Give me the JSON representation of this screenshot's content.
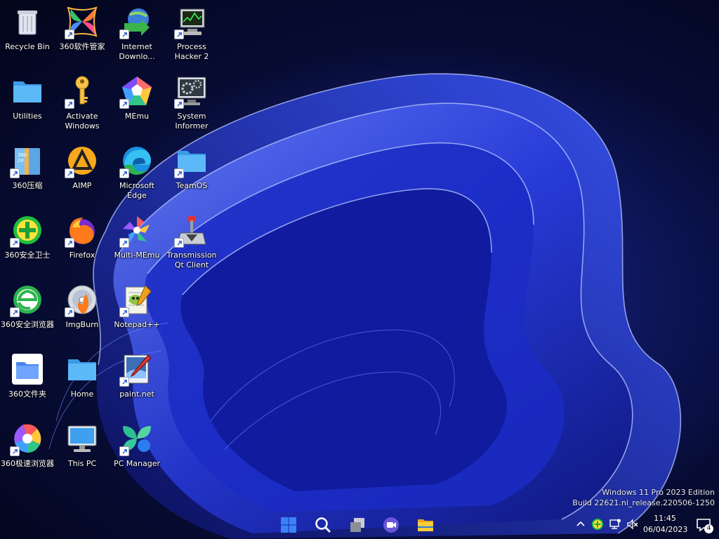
{
  "desktop_icons": [
    {
      "label": "Recycle Bin",
      "icon": "recycle-bin-icon",
      "shortcut": false
    },
    {
      "label": "360软件管家",
      "icon": "360-software-manager-icon",
      "shortcut": true
    },
    {
      "label": "Internet Downlo...",
      "icon": "internet-download-manager-icon",
      "shortcut": true
    },
    {
      "label": "Process Hacker 2",
      "icon": "process-hacker-icon",
      "shortcut": true
    },
    {
      "label": "Utilities",
      "icon": "folder-icon",
      "shortcut": false
    },
    {
      "label": "Activate Windows",
      "icon": "key-icon",
      "shortcut": true
    },
    {
      "label": "MEmu",
      "icon": "memu-icon",
      "shortcut": true
    },
    {
      "label": "System Informer",
      "icon": "system-informer-icon",
      "shortcut": true
    },
    {
      "label": "360压缩",
      "icon": "360-zip-icon",
      "shortcut": true
    },
    {
      "label": "AIMP",
      "icon": "aimp-icon",
      "shortcut": true
    },
    {
      "label": "Microsoft Edge",
      "icon": "edge-icon",
      "shortcut": true
    },
    {
      "label": "TeamOS",
      "icon": "folder-icon",
      "shortcut": true
    },
    {
      "label": "360安全卫士",
      "icon": "360-security-icon",
      "shortcut": true
    },
    {
      "label": "Firefox",
      "icon": "firefox-icon",
      "shortcut": true
    },
    {
      "label": "Multi-MEmu",
      "icon": "multi-memu-icon",
      "shortcut": true
    },
    {
      "label": "Transmission Qt Client",
      "icon": "transmission-icon",
      "shortcut": true
    },
    {
      "label": "360安全浏览器",
      "icon": "360-browser-icon",
      "shortcut": true
    },
    {
      "label": "ImgBurn",
      "icon": "imgburn-icon",
      "shortcut": true
    },
    {
      "label": "Notepad++",
      "icon": "notepad-plus-plus-icon",
      "shortcut": true
    },
    {
      "label": "360文件夹",
      "icon": "360-folder-icon",
      "shortcut": false
    },
    {
      "label": "Home",
      "icon": "folder-icon",
      "shortcut": false
    },
    {
      "label": "paint.net",
      "icon": "paint-net-icon",
      "shortcut": true
    },
    {
      "label": "360极速浏览器",
      "icon": "360-speed-browser-icon",
      "shortcut": true
    },
    {
      "label": "This PC",
      "icon": "this-pc-icon",
      "shortcut": false
    },
    {
      "label": "PC Manager",
      "icon": "pc-manager-icon",
      "shortcut": true
    }
  ],
  "watermark": {
    "line1": "Windows 11 Pro 2023 Edition",
    "line2": "Build 22621.ni_release.220506-1250"
  },
  "taskbar": {
    "pinned": [
      "windows-start-icon",
      "search-icon",
      "task-view-icon",
      "teams-chat-icon",
      "file-explorer-icon"
    ],
    "tray": [
      "chevron-up-icon",
      "360-tray-icon",
      "network-icon",
      "volume-muted-icon"
    ],
    "time": "11:45",
    "date": "06/04/2023",
    "notification_count": "4"
  },
  "colors": {
    "accent": "#3a5cff",
    "folder": "#4fb3f5",
    "wallpaper_dark": "#03051a"
  }
}
